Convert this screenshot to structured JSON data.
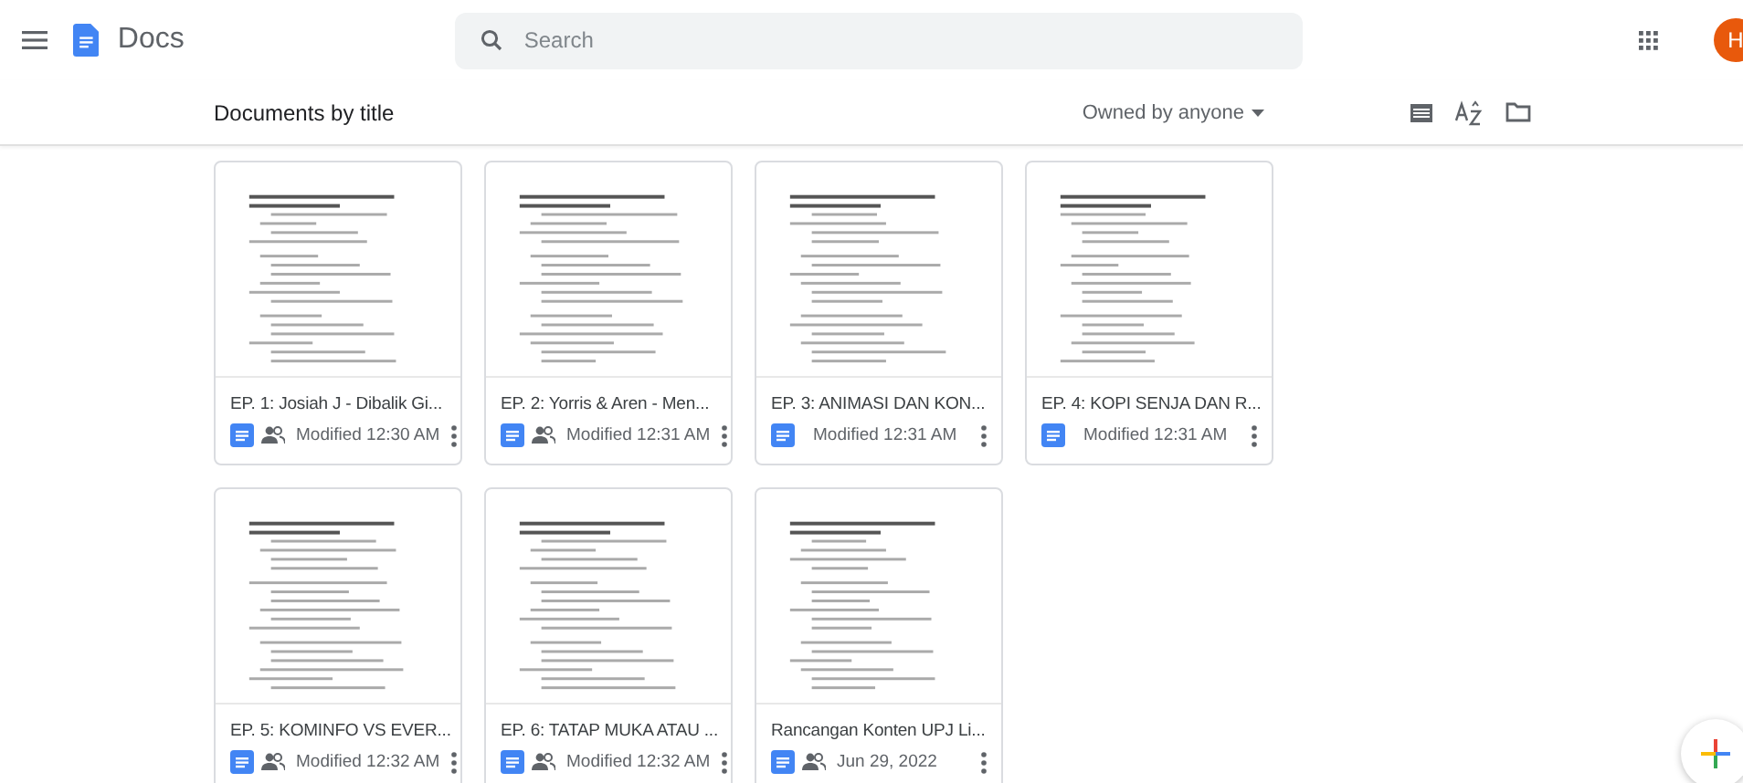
{
  "app": {
    "name": "Docs",
    "avatar_letter": "H"
  },
  "search": {
    "placeholder": "Search"
  },
  "toolbar": {
    "title": "Documents by title",
    "owner_filter": "Owned by anyone"
  },
  "documents": [
    {
      "title": "EP. 1: Josiah J - Dibalik Gi...",
      "shared": true,
      "modified": "Modified 12:30 AM"
    },
    {
      "title": "EP. 2: Yorris & Aren - Men...",
      "shared": true,
      "modified": "Modified 12:31 AM"
    },
    {
      "title": "EP. 3: ANIMASI DAN KON...",
      "shared": false,
      "modified": "Modified 12:31 AM"
    },
    {
      "title": "EP. 4: KOPI SENJA DAN R...",
      "shared": false,
      "modified": "Modified 12:31 AM"
    },
    {
      "title": "EP. 5: KOMINFO VS EVER...",
      "shared": true,
      "modified": "Modified 12:32 AM"
    },
    {
      "title": "EP. 6: TATAP MUKA ATAU ...",
      "shared": true,
      "modified": "Modified 12:32 AM"
    },
    {
      "title": "Rancangan Konten UPJ Li...",
      "shared": true,
      "modified": "Jun 29, 2022"
    }
  ]
}
